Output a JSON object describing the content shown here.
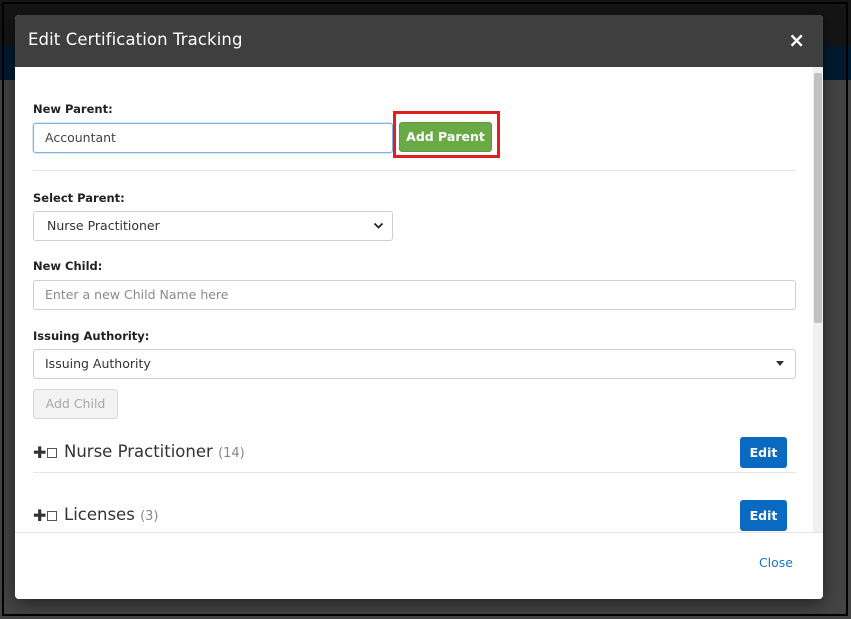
{
  "modal": {
    "title": "Edit Certification Tracking",
    "close_icon": "×"
  },
  "new_parent": {
    "label": "New Parent:",
    "value": "Accountant",
    "button": "Add Parent"
  },
  "select_parent": {
    "label": "Select Parent:",
    "selected": "Nurse Practitioner"
  },
  "new_child": {
    "label": "New Child:",
    "placeholder": "Enter a new Child Name here"
  },
  "issuing_authority": {
    "label": "Issuing Authority:",
    "selected": "Issuing Authority"
  },
  "add_child_button": "Add Child",
  "tree": [
    {
      "name": "Nurse Practitioner",
      "count": "(14)",
      "edit": "Edit"
    },
    {
      "name": "Licenses",
      "count": "(3)",
      "edit": "Edit"
    }
  ],
  "footer": {
    "close": "Close"
  },
  "colors": {
    "header": "#3f3f3f",
    "green_button": "#6aaa46",
    "blue_button": "#0a6ac1",
    "highlight": "#e02020",
    "link": "#1a73c4"
  }
}
